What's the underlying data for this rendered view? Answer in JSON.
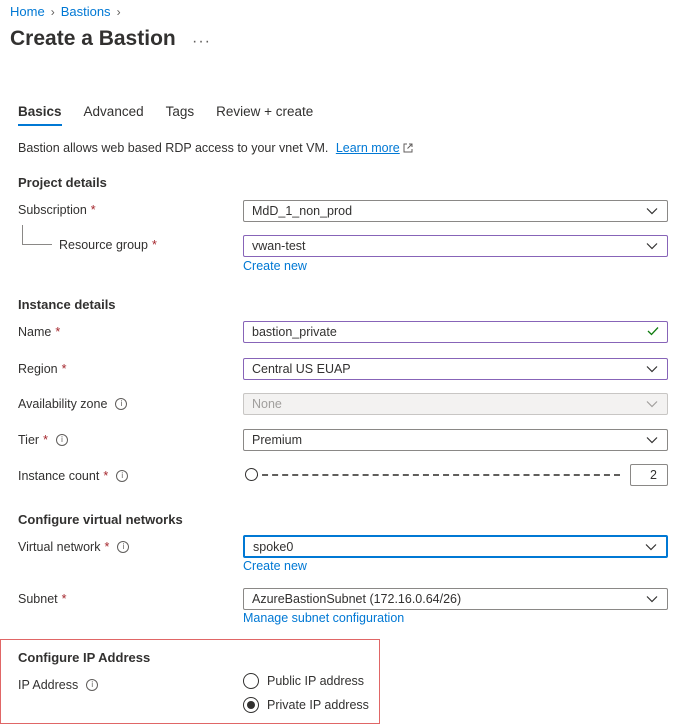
{
  "breadcrumb": {
    "items": [
      "Home",
      "Bastions"
    ]
  },
  "page_title": "Create a Bastion",
  "more_glyph": "···",
  "tabs": [
    {
      "label": "Basics",
      "active": true
    },
    {
      "label": "Advanced",
      "active": false
    },
    {
      "label": "Tags",
      "active": false
    },
    {
      "label": "Review + create",
      "active": false
    }
  ],
  "intro": {
    "text": "Bastion allows web based RDP access to your vnet VM.",
    "link": "Learn more"
  },
  "project": {
    "title": "Project details",
    "subscription_label": "Subscription",
    "subscription_value": "MdD_1_non_prod",
    "resource_group_label": "Resource group",
    "resource_group_value": "vwan-test",
    "create_new": "Create new"
  },
  "instance": {
    "title": "Instance details",
    "name_label": "Name",
    "name_value": "bastion_private",
    "region_label": "Region",
    "region_value": "Central US EUAP",
    "zone_label": "Availability zone",
    "zone_value": "None",
    "tier_label": "Tier",
    "tier_value": "Premium",
    "count_label": "Instance count",
    "count_value": "2",
    "slider_level": 0
  },
  "network": {
    "title": "Configure virtual networks",
    "vnet_label": "Virtual network",
    "vnet_value": "spoke0",
    "create_new": "Create new",
    "subnet_label": "Subnet",
    "subnet_value": "AzureBastionSubnet (172.16.0.64/26)",
    "manage_link": "Manage subnet configuration"
  },
  "ip": {
    "title": "Configure IP Address",
    "label": "IP Address",
    "options": [
      {
        "label": "Public IP address",
        "checked": false
      },
      {
        "label": "Private IP address",
        "checked": true
      }
    ]
  },
  "colors": {
    "accent": "#0078d4",
    "required": "#a4262c",
    "highlight_border": "#e06666",
    "focus_border": "#8764b8"
  }
}
